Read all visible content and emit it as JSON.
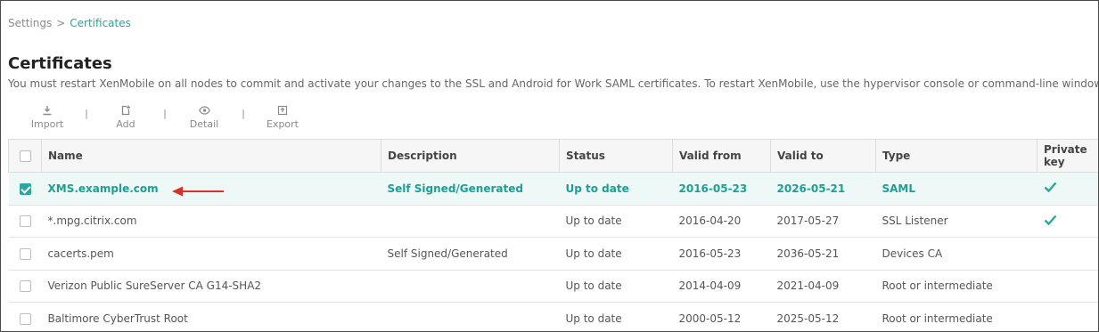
{
  "breadcrumb": {
    "root": "Settings",
    "separator": ">",
    "current": "Certificates"
  },
  "page": {
    "title": "Certificates",
    "notice": "You must restart XenMobile on all nodes to commit and activate your changes to the SSL and Android for Work SAML certificates. To restart XenMobile, use the hypervisor console or command-line window."
  },
  "toolbar": {
    "import_label": "Import",
    "add_label": "Add",
    "detail_label": "Detail",
    "export_label": "Export",
    "separator": "|"
  },
  "table": {
    "columns": {
      "name": "Name",
      "description": "Description",
      "status": "Status",
      "valid_from": "Valid from",
      "valid_to": "Valid to",
      "type": "Type",
      "private_key": "Private key"
    },
    "rows": [
      {
        "selected": true,
        "name": "XMS.example.com",
        "description": "Self Signed/Generated",
        "status": "Up to date",
        "valid_from": "2016-05-23",
        "valid_to": "2026-05-21",
        "type": "SAML",
        "private_key": true
      },
      {
        "selected": false,
        "name": "*.mpg.citrix.com",
        "description": "",
        "status": "Up to date",
        "valid_from": "2016-04-20",
        "valid_to": "2017-05-27",
        "type": "SSL Listener",
        "private_key": true
      },
      {
        "selected": false,
        "name": "cacerts.pem",
        "description": "Self Signed/Generated",
        "status": "Up to date",
        "valid_from": "2016-05-23",
        "valid_to": "2036-05-21",
        "type": "Devices CA",
        "private_key": false
      },
      {
        "selected": false,
        "name": "Verizon Public SureServer CA G14-SHA2",
        "description": "",
        "status": "Up to date",
        "valid_from": "2014-04-09",
        "valid_to": "2021-04-09",
        "type": "Root or intermediate",
        "private_key": false
      },
      {
        "selected": false,
        "name": "Baltimore CyberTrust Root",
        "description": "",
        "status": "Up to date",
        "valid_from": "2000-05-12",
        "valid_to": "2025-05-12",
        "type": "Root or intermediate",
        "private_key": false
      }
    ]
  },
  "colors": {
    "accent": "#28a89e",
    "selected_row_bg": "#eef8f7",
    "annotation_arrow": "#d9302c"
  }
}
